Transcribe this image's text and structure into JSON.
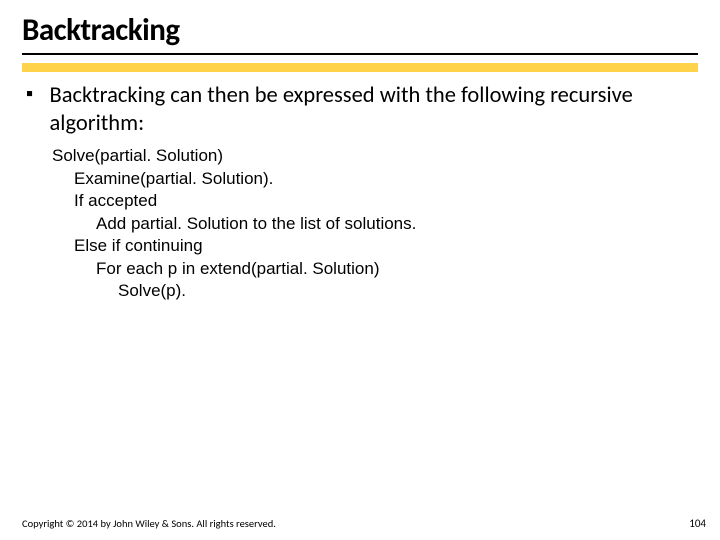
{
  "title": "Backtracking",
  "bullet": "Backtracking can then be expressed with the following recursive algorithm:",
  "code": {
    "l1": "Solve(partial. Solution)",
    "l2": "Examine(partial. Solution).",
    "l3": "If accepted",
    "l4": "Add partial. Solution to the list of solutions.",
    "l5": "Else if continuing",
    "l6": "For each p in extend(partial. Solution)",
    "l7": "Solve(p)."
  },
  "footer": {
    "copyright": "Copyright © 2014 by John Wiley & Sons. All rights reserved.",
    "page": "104"
  }
}
